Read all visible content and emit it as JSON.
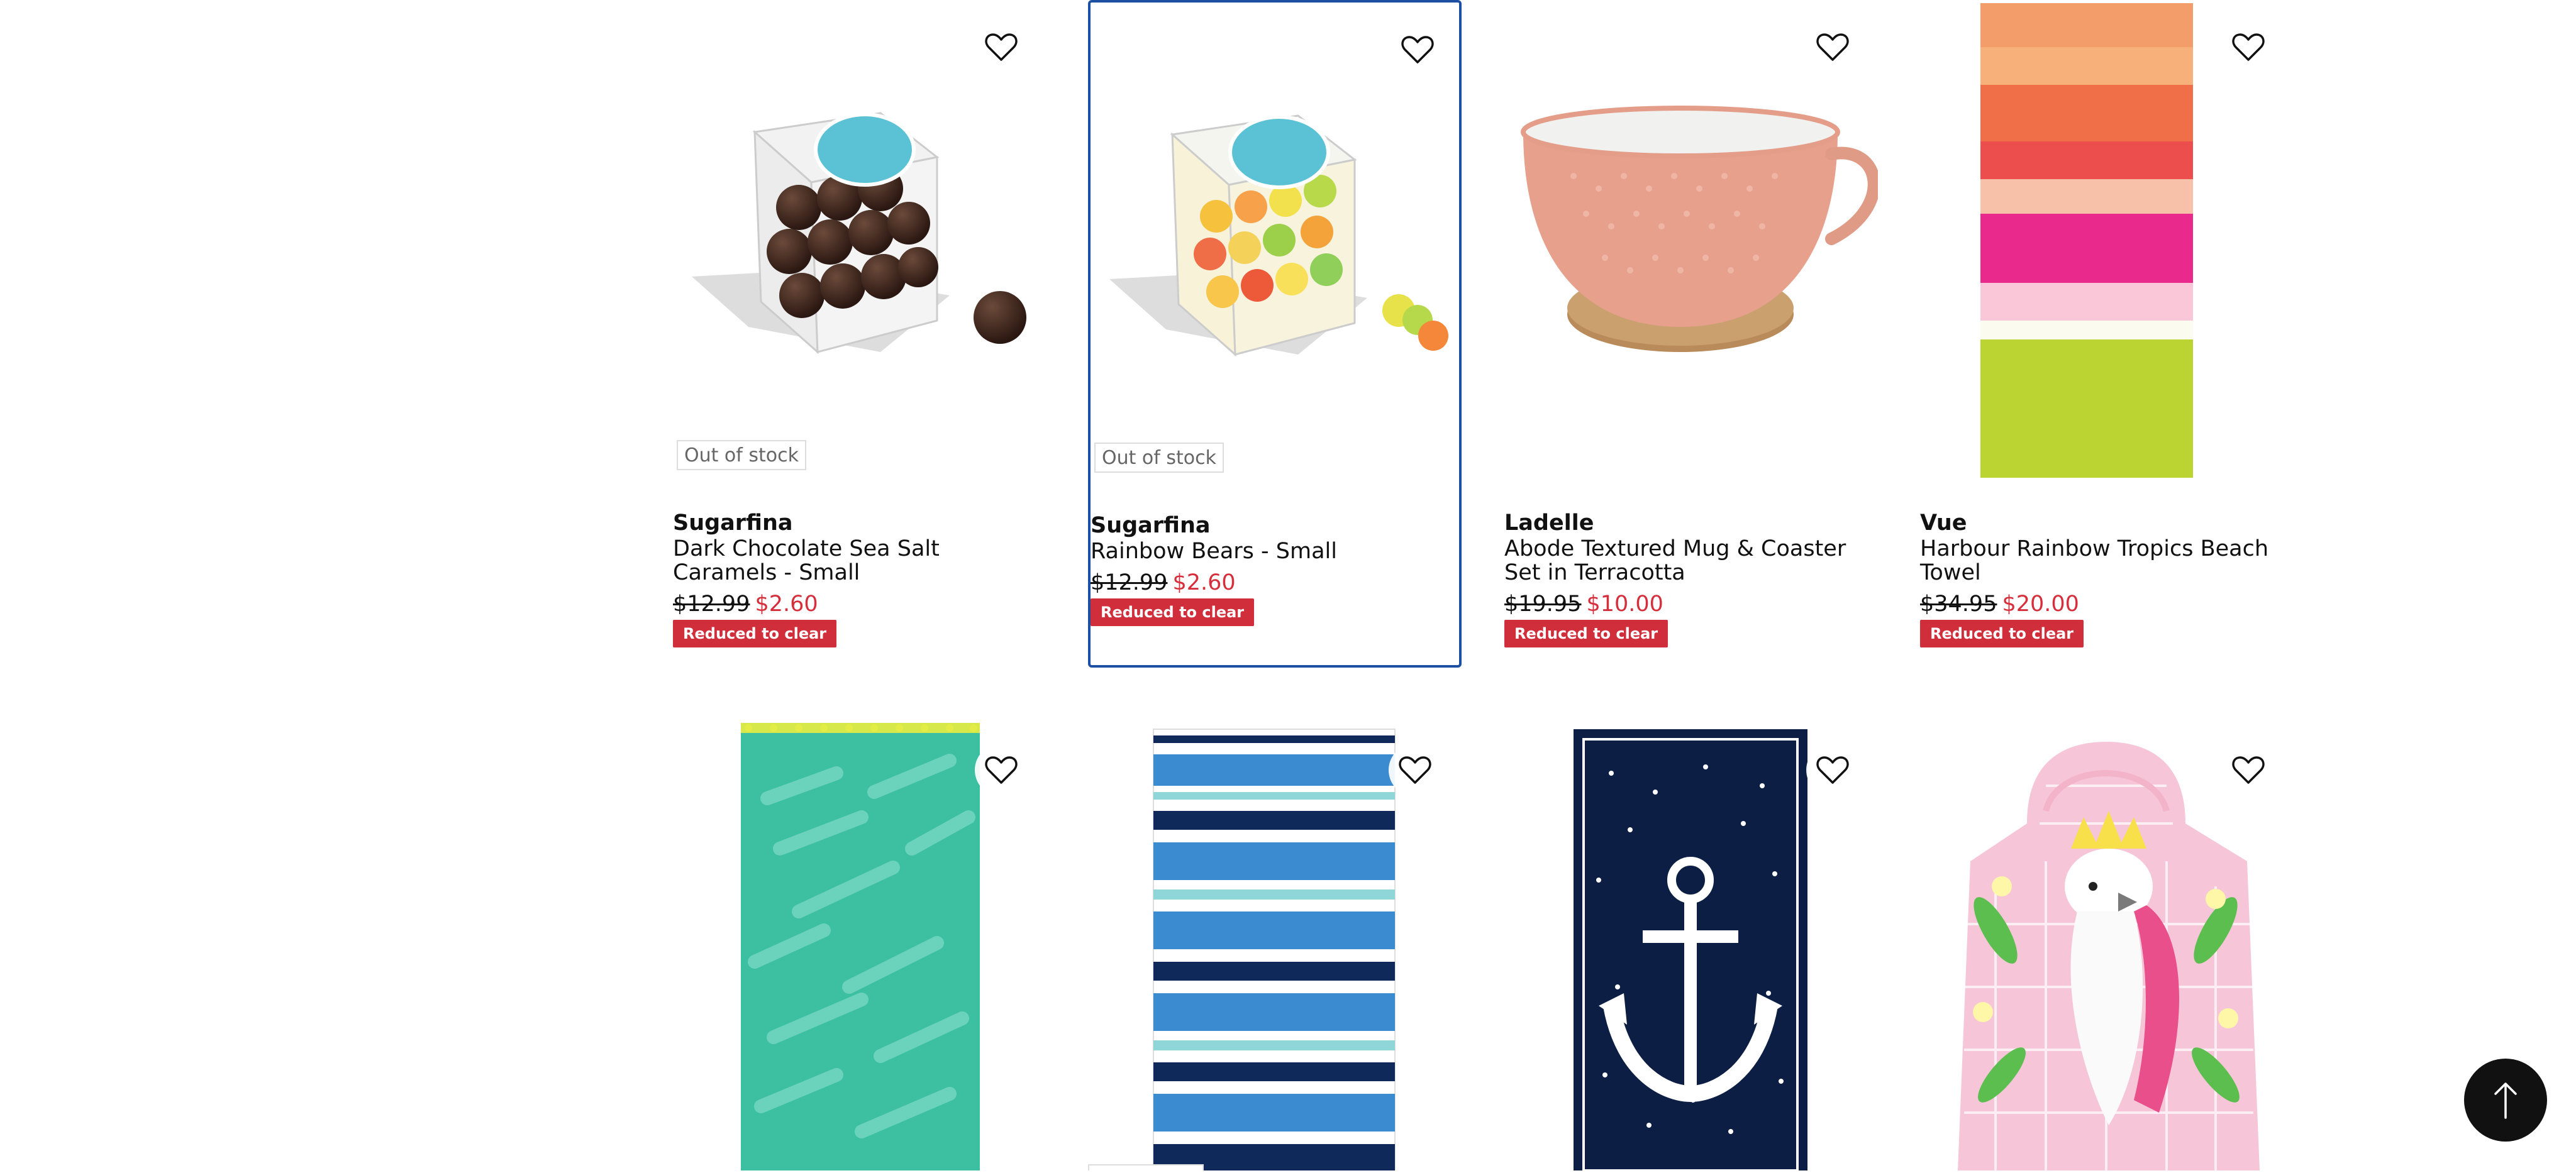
{
  "products": [
    {
      "brand": "Sugarfina",
      "title": "Dark Chocolate Sea Salt Caramels - Small",
      "was": "$12.99",
      "now": "$2.60",
      "badge": "Reduced to clear",
      "stock": "Out of stock"
    },
    {
      "brand": "Sugarfina",
      "title": "Rainbow Bears - Small",
      "was": "$12.99",
      "now": "$2.60",
      "badge": "Reduced to clear",
      "stock": "Out of stock"
    },
    {
      "brand": "Ladelle",
      "title": "Abode Textured Mug & Coaster Set in Terracotta",
      "was": "$19.95",
      "now": "$10.00",
      "badge": "Reduced to clear",
      "stock": ""
    },
    {
      "brand": "Vue",
      "title": "Harbour Rainbow Tropics Beach Towel",
      "was": "$34.95",
      "now": "$20.00",
      "badge": "Reduced to clear",
      "stock": ""
    }
  ],
  "colors": {
    "accent": "#d12e3b",
    "sale_price": "#d62e3a",
    "selection": "#1d4fa3"
  },
  "icons": {
    "wishlist": "heart-icon",
    "back_to_top": "arrow-up-icon"
  }
}
